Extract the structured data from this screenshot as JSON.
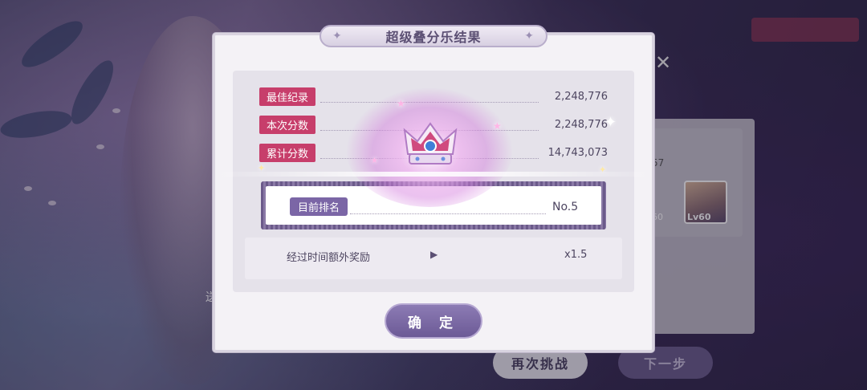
{
  "dialog": {
    "title": "超级叠分乐结果",
    "rows": [
      {
        "label": "最佳纪录",
        "value": "2,248,776"
      },
      {
        "label": "本次分数",
        "value": "2,248,776"
      },
      {
        "label": "累计分数",
        "value": "14,743,073"
      }
    ],
    "rank": {
      "label": "目前排名",
      "value": "No.5"
    },
    "bonus": {
      "label": "经过时间额外奖励",
      "value": "x1.5"
    },
    "confirm_label": "确 定"
  },
  "background": {
    "retry_label": "再次挑战",
    "next_label": "下一步",
    "avatar_level": "Lv60",
    "avatar_level_partial": "60",
    "number_partial": "57",
    "side_text": "送"
  },
  "colors": {
    "accent_pink": "#c73e6b",
    "accent_purple": "#7b66a6",
    "button_purple": "#6c5a96"
  },
  "icons": [
    "crown-icon",
    "sparkle-icon",
    "close-icon",
    "play-arrow-icon"
  ]
}
